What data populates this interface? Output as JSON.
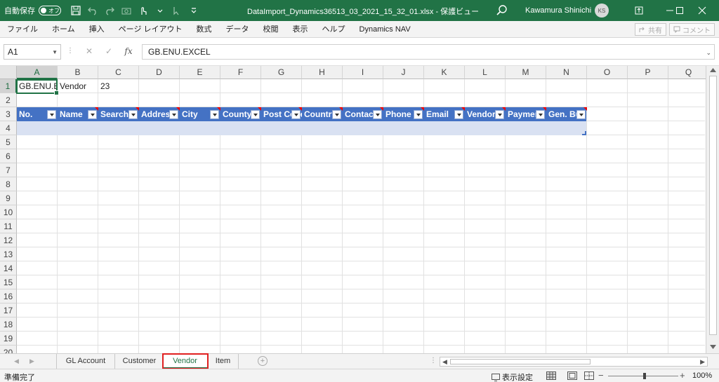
{
  "titlebar": {
    "autosave_label": "自動保存",
    "autosave_state": "オフ",
    "document_title": "DataImport_Dynamics36513_03_2021_15_32_01.xlsx  -  保護ビュー",
    "user_name": "Kawamura Shinichi",
    "user_initials": "KS",
    "accent_color": "#217346"
  },
  "ribbon": {
    "tabs": [
      "ファイル",
      "ホーム",
      "挿入",
      "ページ レイアウト",
      "数式",
      "データ",
      "校閲",
      "表示",
      "ヘルプ",
      "Dynamics NAV"
    ],
    "share_label": "共有",
    "comment_label": "コメント"
  },
  "formula_bar": {
    "name_box": "A1",
    "formula": "GB.ENU.EXCEL"
  },
  "grid": {
    "columns": [
      "A",
      "B",
      "C",
      "D",
      "E",
      "F",
      "G",
      "H",
      "I",
      "J",
      "K",
      "L",
      "M",
      "N",
      "O",
      "P",
      "Q"
    ],
    "rows": [
      "1",
      "2",
      "3",
      "4",
      "5",
      "6",
      "7",
      "8",
      "9",
      "10",
      "11",
      "12",
      "13",
      "14",
      "15",
      "16",
      "17",
      "18",
      "19",
      "20"
    ],
    "row1": [
      "GB.ENU.E",
      "Vendor",
      "23"
    ],
    "table_headers": [
      "No.",
      "Name",
      "Search",
      "Address",
      "City",
      "County",
      "Post Code",
      "Country",
      "Contact",
      "Phone",
      "Email",
      "Vendor",
      "Payment",
      "Gen. Bus"
    ],
    "table_header_color": "#4472c4",
    "table_row_color": "#d9e1f2"
  },
  "sheets": {
    "tabs": [
      "GL Account",
      "Customer",
      "Vendor",
      "Item"
    ],
    "active": "Vendor"
  },
  "statusbar": {
    "status": "準備完了",
    "display_settings": "表示設定",
    "zoom": "100%",
    "zoom_minus": "−",
    "zoom_plus": "+"
  }
}
